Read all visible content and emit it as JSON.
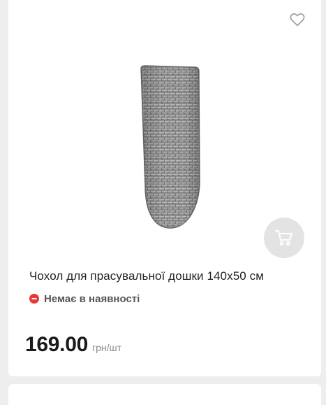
{
  "product": {
    "title": "Чохол для прасувальної дошки 140х50 см",
    "availability": "Немає в наявності",
    "price": "169.00",
    "price_unit": "грн/шт"
  },
  "icons": {
    "wishlist": "heart-outline-icon",
    "cart": "cart-icon",
    "availability_status": "minus-circle-icon"
  },
  "colors": {
    "status_unavailable": "#e53935",
    "cart_button_bg": "#e3e3e3",
    "price_text": "#1a1a1a"
  }
}
